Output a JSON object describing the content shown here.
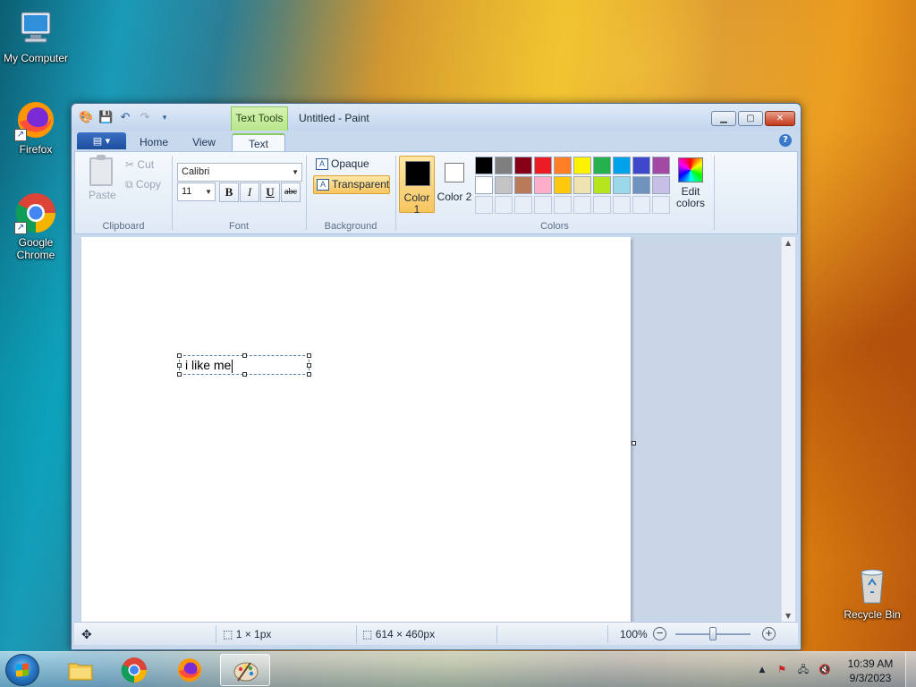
{
  "desktop": {
    "icons": [
      {
        "label": "My Computer"
      },
      {
        "label": "Firefox"
      },
      {
        "label": "Google Chrome"
      },
      {
        "label": "Recycle Bin"
      }
    ]
  },
  "window": {
    "title": "Untitled - Paint",
    "context_tab": "Text Tools",
    "help": "?"
  },
  "tabs": [
    {
      "label": "Home"
    },
    {
      "label": "View"
    },
    {
      "label": "Text"
    }
  ],
  "ribbon": {
    "clipboard": {
      "paste": "Paste",
      "cut": "Cut",
      "copy": "Copy",
      "group": "Clipboard"
    },
    "font": {
      "family": "Calibri",
      "size": "11",
      "bold": "B",
      "italic": "I",
      "underline": "U",
      "strike": "abc",
      "group": "Font"
    },
    "background": {
      "opaque": "Opaque",
      "transparent": "Transparent",
      "group": "Background"
    },
    "colors": {
      "color1_label": "Color 1",
      "color2_label": "Color 2",
      "color1": "#000000",
      "color2": "#ffffff",
      "edit": "Edit colors",
      "group": "Colors",
      "palette_row1": [
        "#000000",
        "#7f7f7f",
        "#880015",
        "#ed1c24",
        "#ff7f27",
        "#fff200",
        "#22b14c",
        "#00a2e8",
        "#3f48cc",
        "#a349a4"
      ],
      "palette_row2": [
        "#ffffff",
        "#c3c3c3",
        "#b97a57",
        "#ffaec9",
        "#ffc90e",
        "#efe4b0",
        "#b5e61d",
        "#99d9ea",
        "#7092be",
        "#c8bfe7"
      ]
    }
  },
  "canvas": {
    "text": "i like me"
  },
  "status": {
    "selection": "1 × 1px",
    "size": "614 × 460px",
    "zoom": "100%"
  },
  "taskbar": {
    "time": "10:39 AM",
    "date": "9/3/2023"
  }
}
